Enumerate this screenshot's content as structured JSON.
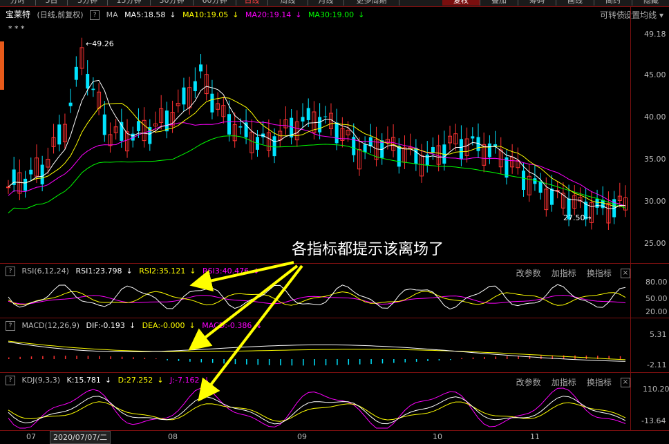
{
  "tabs": [
    "分时",
    "5日",
    "5分钟",
    "15分钟",
    "30分钟",
    "60分钟",
    "日线",
    "周线",
    "月线",
    "更多周期",
    "复权",
    "叠加",
    "筹码",
    "画线",
    "简约",
    "隐藏"
  ],
  "main_header": {
    "stock_name": "宝莱特",
    "mode": "(日线,前复权)",
    "ma_label": "MA",
    "ma5": "MA5:18.58",
    "ma10": "MA10:19.05",
    "ma20": "MA20:19.14",
    "ma30": "MA30:19.00",
    "right_link1": "可转债",
    "right_link2": "设置均线"
  },
  "price_axis": [
    "49.18",
    "45.00",
    "40.00",
    "35.00",
    "30.00",
    "25.00"
  ],
  "annot_high": "49.26",
  "annot_low": "27.50",
  "annotation_text": "各指标都提示该离场了",
  "rsi_header": {
    "name": "RSI(6,12,24)",
    "v1": "RSI1:23.798",
    "v2": "RSI2:35.121",
    "v3": "RSI3:40.476"
  },
  "rsi_axis": [
    "80.00",
    "50.00",
    "20.00"
  ],
  "macd_header": {
    "name": "MACD(12,26,9)",
    "v1": "DIF:-0.193",
    "v2": "DEA:-0.000",
    "v3": "MACD:-0.386"
  },
  "macd_axis": [
    "5.31",
    "-2.11"
  ],
  "kdj_header": {
    "name": "KDJ(9,3,3)",
    "v1": "K:15.781",
    "v2": "D:27.252",
    "v3": "J:-7.162"
  },
  "kdj_axis": [
    "110.20",
    "-13.64"
  ],
  "panel_buttons": {
    "change": "改参数",
    "add": "加指标",
    "swap": "换指标"
  },
  "dates": {
    "d1": "07",
    "selected": "2020/07/07/二",
    "d2": "08",
    "d3": "09",
    "d4": "10",
    "d5": "11"
  },
  "colors": {
    "up": "#ff3232",
    "down": "#00e4ff",
    "ma5": "#ffffff",
    "ma10": "#ffff00",
    "ma20": "#ff00ff",
    "ma30": "#00ff00",
    "arrow": "#ffff00"
  }
}
